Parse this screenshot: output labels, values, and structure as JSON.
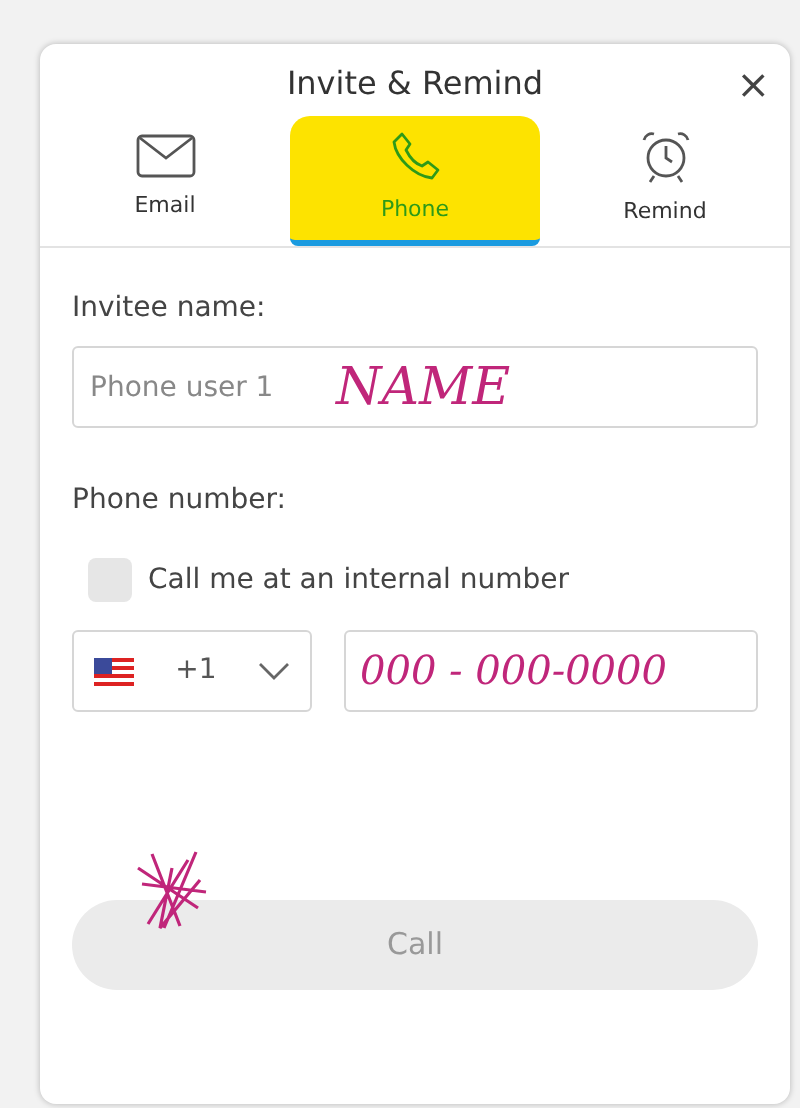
{
  "dialog": {
    "title": "Invite & Remind",
    "close": "×"
  },
  "tabs": [
    {
      "label": "Email",
      "kind": "envelope",
      "selected": false,
      "highlighted": false
    },
    {
      "label": "Phone",
      "kind": "phone",
      "selected": true,
      "highlighted": true
    },
    {
      "label": "Remind",
      "kind": "clock",
      "selected": false,
      "highlighted": false
    }
  ],
  "invitee": {
    "label": "Invitee name:",
    "placeholder": "Phone user 1",
    "ink": "NAME"
  },
  "phone": {
    "label": "Phone number:",
    "checkbox": {
      "label": "Call me at an internal number",
      "checked": false
    },
    "country_code": "+1",
    "ink": "000 - 000-0000"
  },
  "call_button": {
    "label": "Call",
    "disabled": true
  },
  "scribble": {
    "kind": "star"
  }
}
